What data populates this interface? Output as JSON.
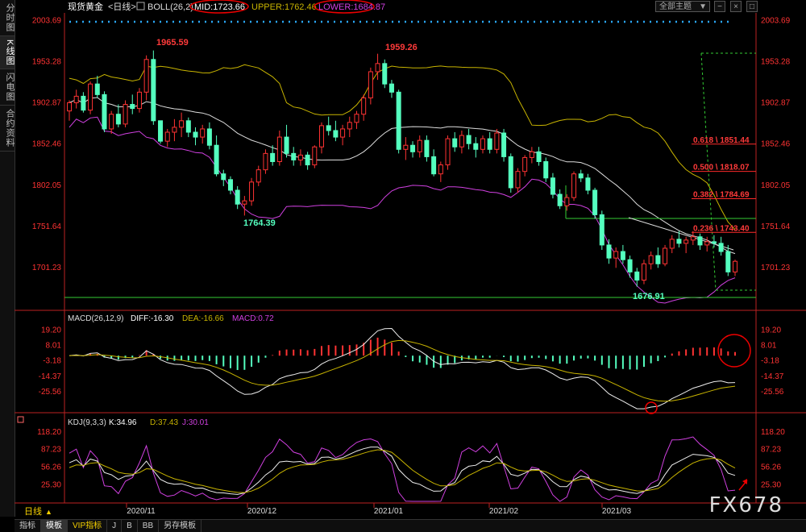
{
  "sidebar": {
    "tabs": [
      "分时图",
      "K线图",
      "闪电图",
      "合约资料"
    ],
    "active": 1
  },
  "header": {
    "instrument": "现货黄金",
    "period": "<日线>",
    "boll_label": "BOLL(26,2)",
    "mid_label": "MID:1723.66",
    "upper_label": "UPPER:1762.46",
    "lower_label": "LOWER:1684.87",
    "theme": "全部主题",
    "theme_arrow": "▼"
  },
  "colors": {
    "up": "#ff3333",
    "down": "#54ffbf",
    "mid": "#dddddd",
    "upper": "#c8b400",
    "lower": "#d040e0",
    "fib": "#ff2a2a",
    "support": "#33cc33",
    "axis_text": "#ff3333",
    "annot_red": "#ff3a3a"
  },
  "price_axis": {
    "min": 1650,
    "max": 2010,
    "ticks": [
      "2003.69",
      "1953.28",
      "1902.87",
      "1852.46",
      "1802.05",
      "1751.64",
      "1701.23"
    ]
  },
  "annotations": {
    "high1": "1965.59",
    "high2": "1959.26",
    "low1": "1764.39",
    "low2": "1676.91"
  },
  "fib_levels": [
    {
      "label": "0.618 \\ 1851.44",
      "price": 1851.44
    },
    {
      "label": "0.500 \\ 1818.07",
      "price": 1818.07
    },
    {
      "label": "0.382 \\ 1784.69",
      "price": 1784.69
    },
    {
      "label": "0.236 \\ 1743.40",
      "price": 1743.4
    }
  ],
  "macd": {
    "label": "MACD(26,12,9)",
    "diff_label": "DIFF:-16.30",
    "dea_label": "DEA:-16.66",
    "macd_label": "MACD:0.72",
    "ticks": [
      "19.20",
      "8.01",
      "-3.18",
      "-14.37",
      "-25.56"
    ],
    "min": -40,
    "max": 24
  },
  "kdj": {
    "label": "KDJ(9,3,3)",
    "k_label": "K:34.96",
    "d_label": "D:37.43",
    "j_label": "J:30.01",
    "ticks": [
      "118.20",
      "87.23",
      "56.26",
      "25.30"
    ],
    "min": -5,
    "max": 125
  },
  "x_axis": {
    "dates": [
      "2020/11",
      "2020/12",
      "2021/01",
      "2021/02",
      "2021/03"
    ]
  },
  "period_button": "日线",
  "period_arrow": "▲",
  "bottom_tabs": [
    "指标",
    "模板",
    "VIP指标",
    "J",
    "B",
    "BB",
    "另存模板"
  ],
  "bottom_active": 1,
  "watermark": "FX678",
  "chart_data": {
    "type": "candlestick",
    "series": [
      {
        "name": "现货黄金",
        "ohlc": [
          [
            1892,
            1905,
            1880,
            1902
          ],
          [
            1902,
            1918,
            1895,
            1910
          ],
          [
            1910,
            1915,
            1890,
            1893
          ],
          [
            1893,
            1928,
            1888,
            1925
          ],
          [
            1925,
            1935,
            1908,
            1912
          ],
          [
            1912,
            1916,
            1866,
            1870
          ],
          [
            1870,
            1892,
            1864,
            1888
          ],
          [
            1888,
            1900,
            1872,
            1876
          ],
          [
            1876,
            1905,
            1872,
            1900
          ],
          [
            1900,
            1912,
            1888,
            1895
          ],
          [
            1895,
            1920,
            1890,
            1915
          ],
          [
            1915,
            1960,
            1905,
            1955
          ],
          [
            1955,
            1966,
            1875,
            1880
          ],
          [
            1880,
            1878,
            1852,
            1855
          ],
          [
            1855,
            1870,
            1848,
            1866
          ],
          [
            1866,
            1882,
            1855,
            1872
          ],
          [
            1872,
            1890,
            1860,
            1880
          ],
          [
            1880,
            1884,
            1860,
            1866
          ],
          [
            1866,
            1872,
            1850,
            1860
          ],
          [
            1860,
            1875,
            1852,
            1870
          ],
          [
            1870,
            1878,
            1845,
            1850
          ],
          [
            1850,
            1862,
            1812,
            1815
          ],
          [
            1815,
            1820,
            1800,
            1808
          ],
          [
            1808,
            1812,
            1790,
            1795
          ],
          [
            1795,
            1800,
            1772,
            1778
          ],
          [
            1778,
            1788,
            1764,
            1782
          ],
          [
            1782,
            1810,
            1776,
            1805
          ],
          [
            1805,
            1825,
            1800,
            1820
          ],
          [
            1820,
            1845,
            1815,
            1840
          ],
          [
            1840,
            1850,
            1825,
            1830
          ],
          [
            1830,
            1868,
            1825,
            1860
          ],
          [
            1860,
            1875,
            1835,
            1840
          ],
          [
            1840,
            1848,
            1825,
            1832
          ],
          [
            1832,
            1845,
            1825,
            1838
          ],
          [
            1838,
            1842,
            1820,
            1826
          ],
          [
            1826,
            1850,
            1822,
            1848
          ],
          [
            1848,
            1878,
            1840,
            1874
          ],
          [
            1874,
            1885,
            1862,
            1868
          ],
          [
            1868,
            1880,
            1855,
            1860
          ],
          [
            1860,
            1875,
            1850,
            1870
          ],
          [
            1870,
            1885,
            1860,
            1878
          ],
          [
            1878,
            1892,
            1870,
            1888
          ],
          [
            1888,
            1912,
            1880,
            1908
          ],
          [
            1908,
            1945,
            1900,
            1940
          ],
          [
            1940,
            1962,
            1930,
            1950
          ],
          [
            1950,
            1955,
            1920,
            1925
          ],
          [
            1925,
            1930,
            1908,
            1915
          ],
          [
            1915,
            1918,
            1840,
            1845
          ],
          [
            1845,
            1860,
            1832,
            1850
          ],
          [
            1850,
            1855,
            1835,
            1842
          ],
          [
            1842,
            1862,
            1835,
            1856
          ],
          [
            1856,
            1862,
            1830,
            1836
          ],
          [
            1836,
            1845,
            1812,
            1815
          ],
          [
            1815,
            1830,
            1805,
            1826
          ],
          [
            1826,
            1862,
            1820,
            1858
          ],
          [
            1858,
            1866,
            1842,
            1848
          ],
          [
            1848,
            1868,
            1840,
            1862
          ],
          [
            1862,
            1870,
            1845,
            1852
          ],
          [
            1852,
            1860,
            1835,
            1845
          ],
          [
            1845,
            1862,
            1840,
            1858
          ],
          [
            1858,
            1866,
            1840,
            1845
          ],
          [
            1845,
            1870,
            1840,
            1865
          ],
          [
            1865,
            1870,
            1830,
            1836
          ],
          [
            1836,
            1840,
            1792,
            1798
          ],
          [
            1798,
            1822,
            1792,
            1818
          ],
          [
            1818,
            1838,
            1812,
            1835
          ],
          [
            1835,
            1848,
            1828,
            1842
          ],
          [
            1842,
            1848,
            1825,
            1830
          ],
          [
            1830,
            1835,
            1805,
            1810
          ],
          [
            1810,
            1816,
            1785,
            1790
          ],
          [
            1790,
            1796,
            1772,
            1776
          ],
          [
            1776,
            1790,
            1770,
            1786
          ],
          [
            1786,
            1818,
            1782,
            1815
          ],
          [
            1815,
            1820,
            1805,
            1810
          ],
          [
            1810,
            1815,
            1790,
            1795
          ],
          [
            1795,
            1798,
            1760,
            1765
          ],
          [
            1765,
            1770,
            1722,
            1728
          ],
          [
            1728,
            1735,
            1705,
            1712
          ],
          [
            1712,
            1725,
            1700,
            1720
          ],
          [
            1720,
            1728,
            1705,
            1710
          ],
          [
            1710,
            1715,
            1688,
            1695
          ],
          [
            1695,
            1700,
            1677,
            1685
          ],
          [
            1685,
            1710,
            1680,
            1705
          ],
          [
            1705,
            1720,
            1698,
            1715
          ],
          [
            1715,
            1725,
            1700,
            1705
          ],
          [
            1705,
            1728,
            1702,
            1724
          ],
          [
            1724,
            1740,
            1718,
            1735
          ],
          [
            1735,
            1745,
            1725,
            1730
          ],
          [
            1730,
            1738,
            1718,
            1734
          ],
          [
            1734,
            1745,
            1728,
            1738
          ],
          [
            1738,
            1742,
            1722,
            1728
          ],
          [
            1728,
            1738,
            1720,
            1732
          ],
          [
            1732,
            1740,
            1725,
            1730
          ],
          [
            1730,
            1738,
            1715,
            1720
          ],
          [
            1720,
            1728,
            1690,
            1695
          ],
          [
            1695,
            1710,
            1690,
            1708
          ]
        ]
      }
    ],
    "x_dates": [
      "2020/11",
      "2020/12",
      "2021/01",
      "2021/02",
      "2021/03"
    ],
    "ylim": [
      1650,
      2010
    ]
  }
}
